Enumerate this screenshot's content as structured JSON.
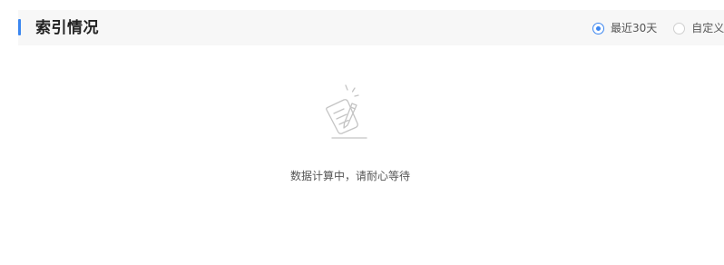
{
  "section": {
    "title": "索引情况"
  },
  "range_selector": {
    "options": [
      {
        "label": "最近30天",
        "selected": true
      },
      {
        "label": "自定义日",
        "selected": false
      }
    ]
  },
  "empty_state": {
    "icon": "notepad-pencil-icon",
    "message": "数据计算中，请耐心等待"
  },
  "colors": {
    "accent": "#3b86f0",
    "header_background": "#f7f7f7",
    "icon_stroke": "#c4c4c4"
  }
}
